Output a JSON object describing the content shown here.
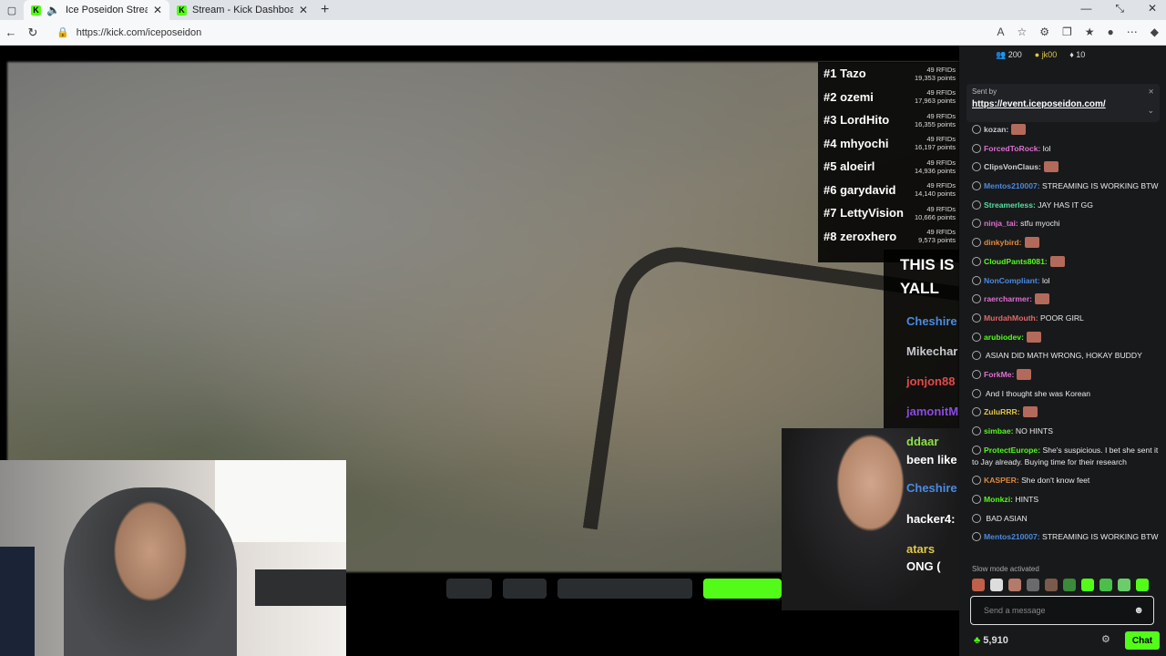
{
  "browser": {
    "tabs": [
      {
        "title": "Ice Poseidon Stream - Watch",
        "active": true
      },
      {
        "title": "Stream - Kick Dashboard",
        "active": false
      }
    ],
    "url": "https://kick.com/iceposeidon",
    "new_tab": "+",
    "win_min": "—",
    "win_restore": "⤡",
    "win_close": "✕"
  },
  "leaderboard": [
    {
      "name": "#1 Tazo",
      "rfids": "49 RFIDs",
      "points": "19,353 points"
    },
    {
      "name": "#2 ozemi",
      "rfids": "49 RFIDs",
      "points": "17,963 points"
    },
    {
      "name": "#3 LordHito",
      "rfids": "49 RFIDs",
      "points": "16,355 points"
    },
    {
      "name": "#4 mhyochi",
      "rfids": "49 RFIDs",
      "points": "16,197 points"
    },
    {
      "name": "#5 aloeirl",
      "rfids": "49 RFIDs",
      "points": "14,936 points"
    },
    {
      "name": "#6 garydavid",
      "rfids": "49 RFIDs",
      "points": "14,140 points"
    },
    {
      "name": "#7 LettyVision",
      "rfids": "49 RFIDs",
      "points": "10,666 points"
    },
    {
      "name": "#8 zeroxhero",
      "rfids": "49 RFIDs",
      "points": "9,573 points"
    }
  ],
  "overlay": {
    "line1": "THIS IS",
    "line2": "YALL",
    "names": [
      {
        "text": "Cheshire",
        "color": "#4a8be0"
      },
      {
        "text": "Mikechar",
        "color": "#c8c8d0"
      },
      {
        "text": "jonjon88",
        "color": "#e04a4a"
      },
      {
        "text": "jamonitM",
        "color": "#8a4ae0"
      },
      {
        "text": "ddaar",
        "color": "#8fe04a"
      },
      {
        "text": "been like",
        "color": "#ffffff"
      },
      {
        "text": "Cheshire",
        "color": "#4a8be0"
      },
      {
        "text": "hacker4:",
        "color": "#ffffff"
      },
      {
        "text": "atars",
        "color": "#e0c84a"
      },
      {
        "text": "ONG (",
        "color": "#ffffff"
      }
    ]
  },
  "chat": {
    "top": {
      "users": "200",
      "badge_user": "jk00",
      "count": "10"
    },
    "pinned": {
      "sent_by": "Sent by",
      "link": "https://event.iceposeidon.com/"
    },
    "messages": [
      {
        "user": "kozan:",
        "color": "#c8c8d0",
        "text": ""
      },
      {
        "user": "ForcedToRock:",
        "color": "#e070d0",
        "text": " lol"
      },
      {
        "user": "ClipsVonClaus:",
        "color": "#d0d0d0",
        "text": ""
      },
      {
        "user": "Mentos210007:",
        "color": "#4a8be0",
        "text": " STREAMING IS WORKING BTW"
      },
      {
        "user": "Streamerless:",
        "color": "#53e0a0",
        "text": " JAY HAS IT GG"
      },
      {
        "user": "ninja_tai:",
        "color": "#e070d0",
        "text": " stfu myochi"
      },
      {
        "user": "dinkybird:",
        "color": "#e08a3a",
        "text": ""
      },
      {
        "user": "CloudPants8081:",
        "color": "#53fc18",
        "text": ""
      },
      {
        "user": "NonCompliant:",
        "color": "#4a8be0",
        "text": " lol"
      },
      {
        "user": "raercharmer:",
        "color": "#e070d0",
        "text": ""
      },
      {
        "user": "MurdahMouth:",
        "color": "#e06a6a",
        "text": " POOR GIRL"
      },
      {
        "user": "arubiodev:",
        "color": "#53fc18",
        "text": ""
      },
      {
        "user": "",
        "color": "#e04a4a",
        "text": " ASIAN DID MATH WRONG, HOKAY BUDDY"
      },
      {
        "user": "ForkMe:",
        "color": "#e070d0",
        "text": ""
      },
      {
        "user": "",
        "color": "#e04a4a",
        "text": " And I thought she was Korean"
      },
      {
        "user": "ZuluRRR:",
        "color": "#e0c84a",
        "text": ""
      },
      {
        "user": "simbae:",
        "color": "#53fc18",
        "text": " NO HINTS"
      },
      {
        "user": "ProtectEurope:",
        "color": "#53fc18",
        "text": " She's suspicious. I bet she sent it to Jay already. Buying time for their research"
      },
      {
        "user": "KASPER:",
        "color": "#e08a3a",
        "text": " She don't know feet"
      },
      {
        "user": "Monkzi:",
        "color": "#53fc18",
        "text": " HINTS"
      },
      {
        "user": "",
        "color": "#e04a4a",
        "text": " BAD ASIAN"
      },
      {
        "user": "Mentos210007:",
        "color": "#4a8be0",
        "text": " STREAMING IS WORKING BTW"
      }
    ],
    "slow_mode": "Slow mode activated",
    "input_placeholder": "Send a message",
    "points": "5,910",
    "send_label": "Chat"
  }
}
